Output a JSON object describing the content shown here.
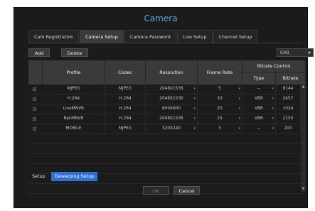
{
  "dialog": {
    "title": "Camera",
    "tabs": [
      {
        "label": "Cam Registration"
      },
      {
        "label": "Camera Setup"
      },
      {
        "label": "Camera Password"
      },
      {
        "label": "Live Setup"
      },
      {
        "label": "Channel Setup"
      }
    ],
    "active_tab": "Camera Setup",
    "toolbar": {
      "add_label": "Add",
      "delete_label": "Delete",
      "channel_value": "CH3"
    },
    "table": {
      "headers": {
        "profile": "Profile",
        "codec": "Codec",
        "resolution": "Resolution",
        "frame_rate": "Frame Rate",
        "bitrate_control": "Bitrate Control",
        "type": "Type",
        "bitrate": "Bitrate"
      },
      "rows": [
        {
          "profile": "MJPEG",
          "codec": "MJPEG",
          "resolution": "2048X1536",
          "frame_rate": "5",
          "type": "--",
          "bitrate": "6144"
        },
        {
          "profile": "H.264",
          "codec": "H.264",
          "resolution": "2048X1536",
          "frame_rate": "20",
          "type": "VBR",
          "bitrate": "2457"
        },
        {
          "profile": "LiveMNVR",
          "codec": "H.264",
          "resolution": "800X600",
          "frame_rate": "20",
          "type": "VBR",
          "bitrate": "1024"
        },
        {
          "profile": "RecMNVR",
          "codec": "H.264",
          "resolution": "2048X1536",
          "frame_rate": "15",
          "type": "VBR",
          "bitrate": "2150"
        },
        {
          "profile": "MOBILE",
          "codec": "MJPEG",
          "resolution": "320X240",
          "frame_rate": "3",
          "type": "--",
          "bitrate": "200"
        }
      ],
      "empty_rows": 6
    },
    "bottom_tabs": [
      {
        "label": "Setup"
      },
      {
        "label": "Dewarping Setup"
      }
    ],
    "footer": {
      "ok_label": "OK",
      "cancel_label": "Cancel"
    },
    "colors": {
      "title": "#5aa9e6",
      "dewarping_tab": "#2f6fd6",
      "background": "#1b1b1b"
    }
  }
}
